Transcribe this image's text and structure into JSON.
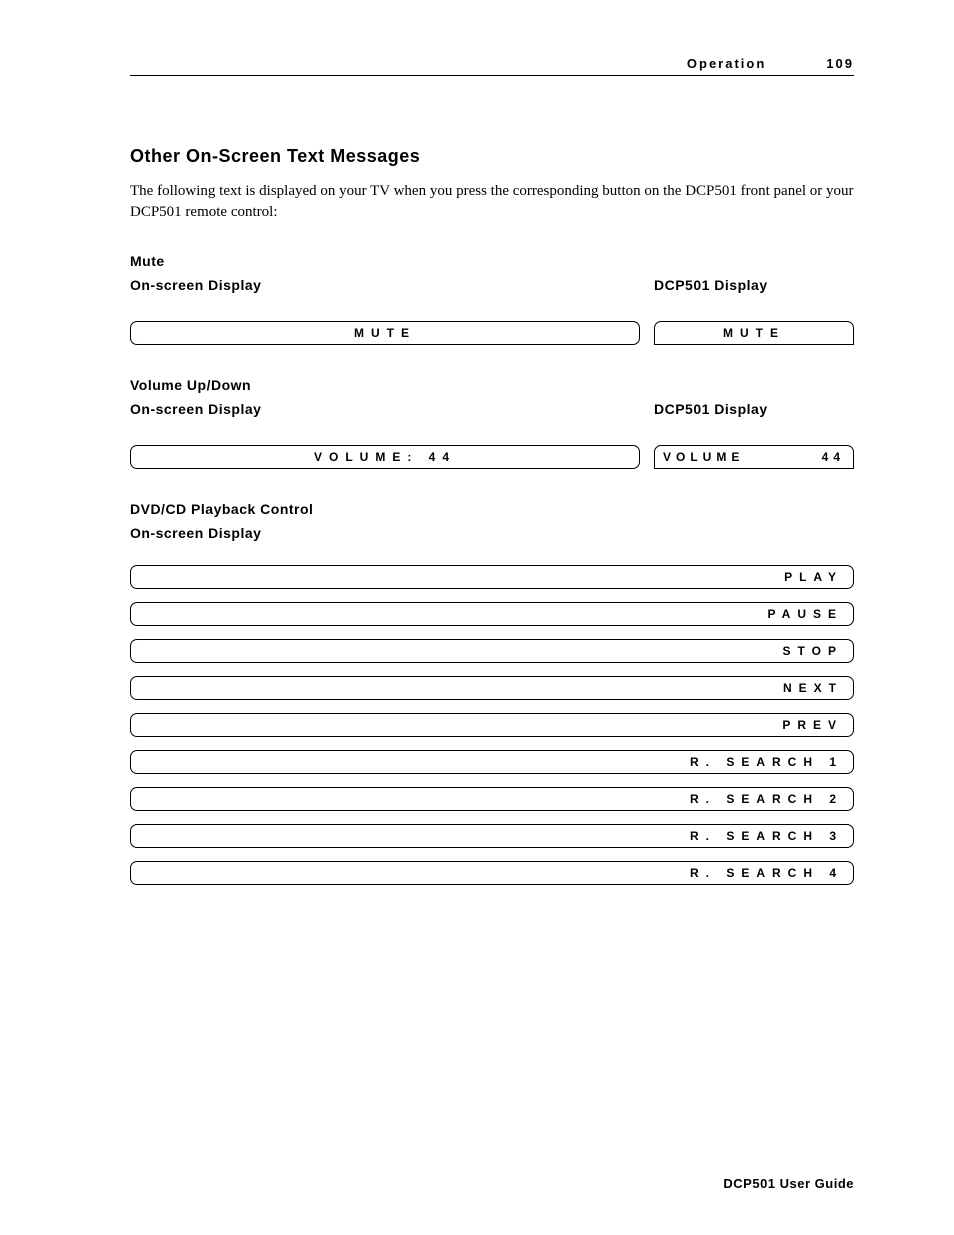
{
  "header": {
    "section": "Operation",
    "page": "109"
  },
  "title": "Other On-Screen Text Messages",
  "intro": "The following text is displayed on your TV when you press the corresponding button on the DCP501 front panel or your DCP501 remote control:",
  "labels": {
    "mute": "Mute",
    "osd": "On-screen Display",
    "dcp": "DCP501 Display",
    "volume": "Volume Up/Down",
    "playback": "DVD/CD Playback Control"
  },
  "mute": {
    "osd": "MUTE",
    "dcp": "MUTE"
  },
  "volume": {
    "osd": "VOLUME: 44",
    "dcp_left": "VOLUME",
    "dcp_right": "44"
  },
  "playback": [
    "PLAY",
    "PAUSE",
    "STOP",
    "NEXT",
    "PREV",
    "R. SEARCH 1",
    "R. SEARCH 2",
    "R. SEARCH 3",
    "R. SEARCH 4"
  ],
  "footer": "DCP501 User Guide"
}
